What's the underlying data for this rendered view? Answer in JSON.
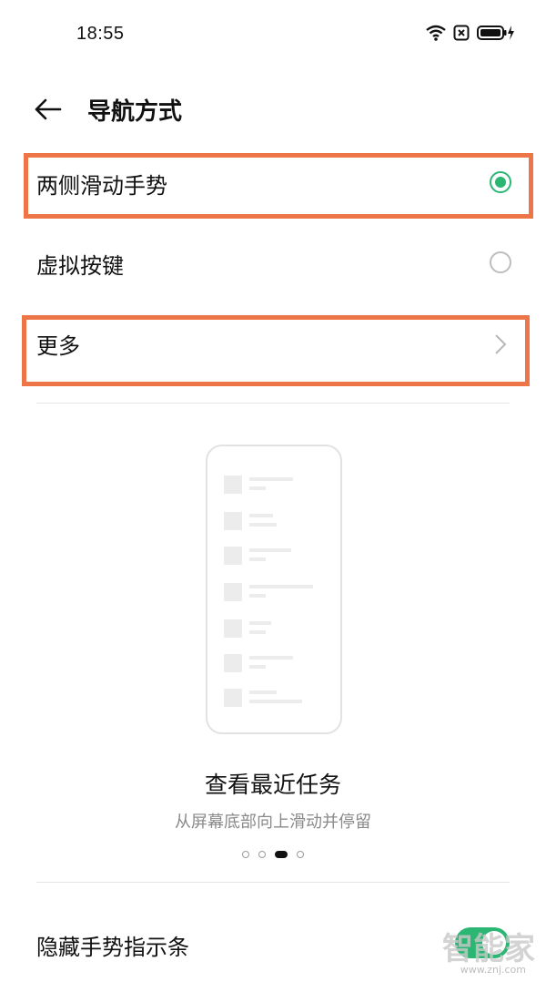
{
  "status": {
    "time": "18:55"
  },
  "header": {
    "title": "导航方式"
  },
  "options": [
    {
      "label": "两侧滑动手势",
      "selected": true
    },
    {
      "label": "虚拟按键",
      "selected": false
    }
  ],
  "more": {
    "label": "更多"
  },
  "gesture": {
    "title": "查看最近任务",
    "subtitle": "从屏幕底部向上滑动并停留",
    "page_index": 3,
    "page_count": 4
  },
  "hide_indicator": {
    "label": "隐藏手势指示条",
    "enabled": true
  },
  "watermark": {
    "text": "智能家",
    "url": "www.znj.com"
  },
  "colors": {
    "accent": "#2bb673",
    "highlight": "#ed7548"
  }
}
